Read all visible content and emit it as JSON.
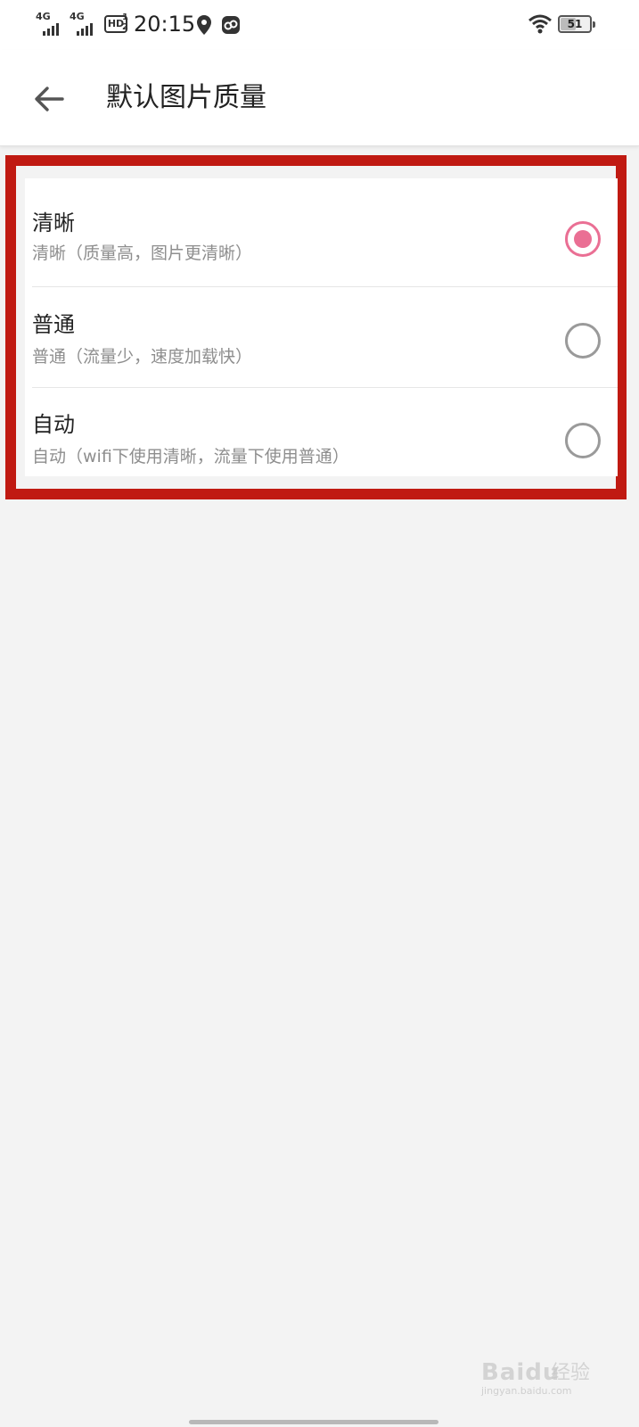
{
  "status_bar": {
    "sim1_network": "4G",
    "sim2_network": "4G",
    "hd_badge": "HD",
    "hd_sub": "1 2",
    "time": "20:15",
    "battery_level": "51",
    "icons": [
      "signal-icon",
      "hd-volte-icon",
      "location-icon",
      "cloud-sync-icon",
      "wifi-icon",
      "battery-icon"
    ]
  },
  "header": {
    "back_icon": "arrow-left-icon",
    "title": "默认图片质量"
  },
  "options": [
    {
      "title": "清晰",
      "description": "清晰（质量高，图片更清晰）",
      "selected": true
    },
    {
      "title": "普通",
      "description": "普通（流量少，速度加载快）",
      "selected": false
    },
    {
      "title": "自动",
      "description": "自动（wifi下使用清晰，流量下使用普通）",
      "selected": false
    }
  ],
  "colors": {
    "accent": "#ea6f94",
    "highlight_frame": "#c01a12",
    "page_background": "#f3f3f3",
    "radio_unchecked": "#9a9a9a"
  },
  "watermark": {
    "logo": "Bai",
    "logo_paw": "du",
    "suffix": "经验",
    "url": "jingyan.baidu.com"
  }
}
